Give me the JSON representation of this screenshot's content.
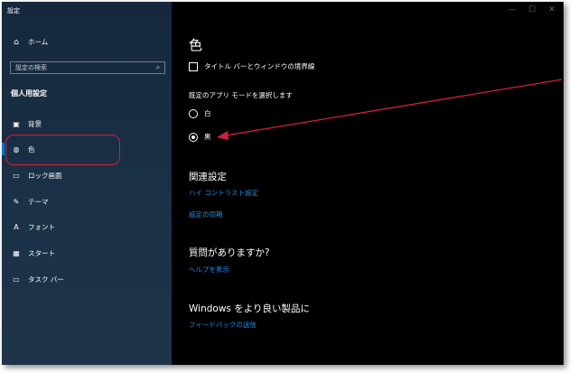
{
  "window": {
    "title": "設定",
    "controls": [
      "—",
      "☐",
      "✕"
    ]
  },
  "sidebar": {
    "home_label": "ホーム",
    "search_placeholder": "設定の検索",
    "section_title": "個人用設定",
    "items": [
      {
        "label": "背景",
        "icon": "image-icon",
        "glyph": "🖼"
      },
      {
        "label": "色",
        "icon": "palette-icon",
        "glyph": "◉",
        "selected": true
      },
      {
        "label": "ロック画面",
        "icon": "lock-screen-icon",
        "glyph": "▭"
      },
      {
        "label": "テーマ",
        "icon": "theme-icon",
        "glyph": "✎"
      },
      {
        "label": "フォント",
        "icon": "font-icon",
        "glyph": "A"
      },
      {
        "label": "スタート",
        "icon": "start-icon",
        "glyph": "▦"
      },
      {
        "label": "タスク バー",
        "icon": "taskbar-icon",
        "glyph": "▭"
      }
    ]
  },
  "main": {
    "title": "色",
    "checkbox_label": "タイトル バーとウィンドウの境界線",
    "app_mode_label": "既定のアプリ モードを選択します",
    "radio_options": [
      {
        "label": "白",
        "checked": false
      },
      {
        "label": "黒",
        "checked": true
      }
    ],
    "related_title": "関連設定",
    "related_links": [
      "ハイ コントラスト設定",
      "設定の同期"
    ],
    "question_title": "質問がありますか?",
    "help_link": "ヘルプを表示",
    "feedback_title": "Windows をより良い製品に",
    "feedback_link": "フィードバックの送信"
  },
  "annotation": {
    "box_color": "#d0213a",
    "arrow_color": "#d0213a"
  },
  "colors": {
    "accent": "#0a74d1",
    "link": "#1a8fe8",
    "sidebar_bg": "#1b3147"
  }
}
